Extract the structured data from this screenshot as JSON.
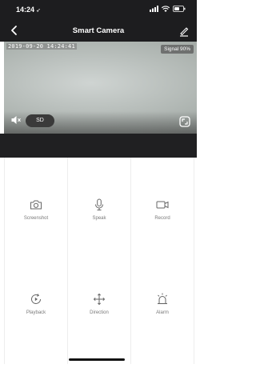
{
  "status_bar": {
    "time": "14:24"
  },
  "nav": {
    "title": "Smart Camera"
  },
  "video": {
    "timestamp": "2019-09-20 14:24:41",
    "signal": "Signal 90%",
    "quality": "SD"
  },
  "controls": [
    {
      "label": "Screenshot",
      "icon": "camera-icon"
    },
    {
      "label": "Speak",
      "icon": "microphone-icon"
    },
    {
      "label": "Record",
      "icon": "video-camera-icon"
    },
    {
      "label": "Playback",
      "icon": "playback-icon"
    },
    {
      "label": "Direction",
      "icon": "direction-arrows-icon"
    },
    {
      "label": "Alarm",
      "icon": "alarm-siren-icon"
    }
  ]
}
